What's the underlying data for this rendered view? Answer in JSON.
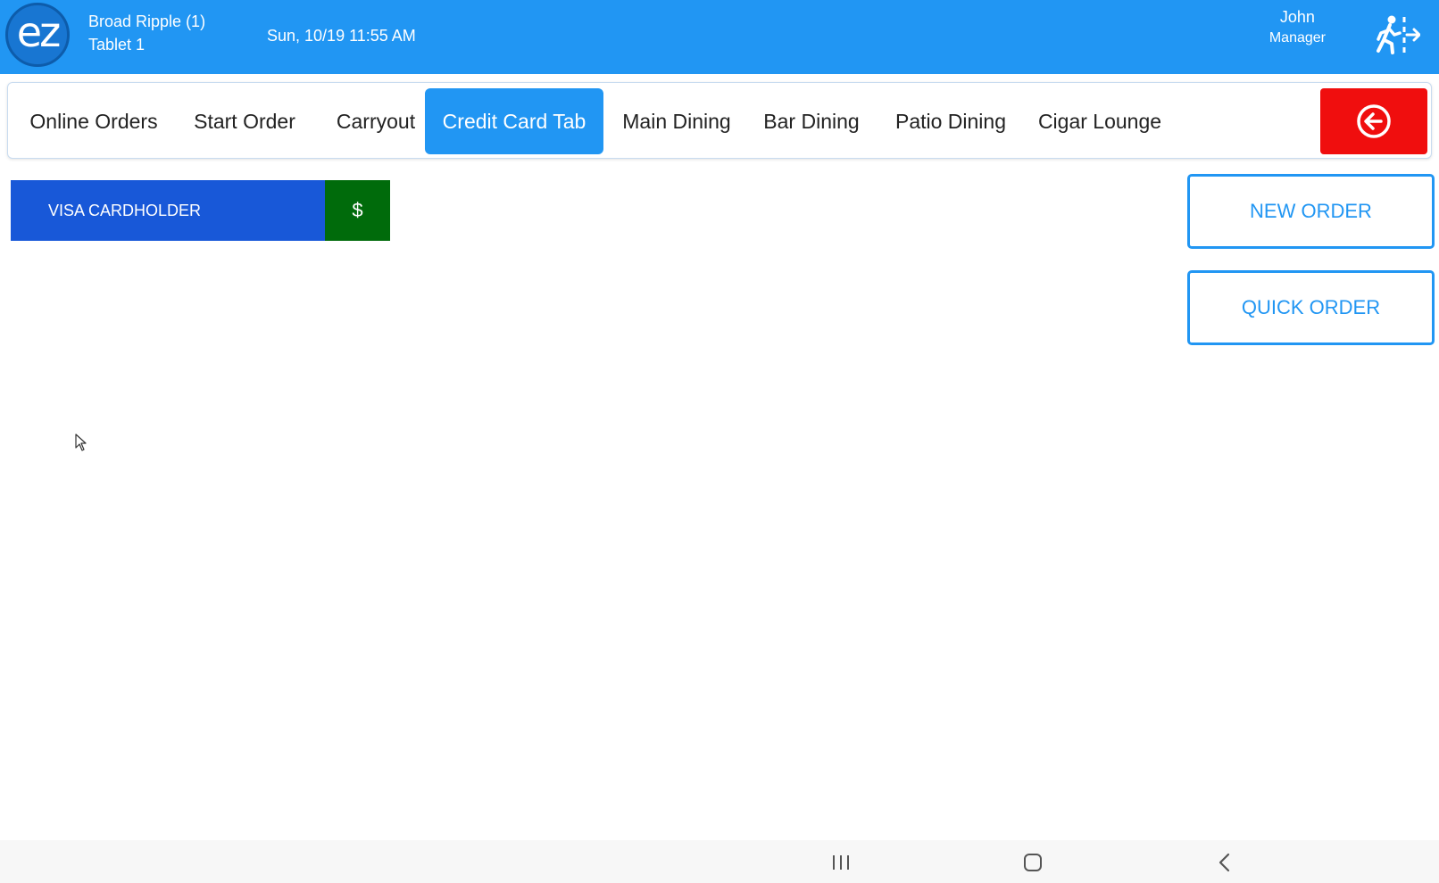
{
  "header": {
    "logo_text": "ez",
    "location": "Broad Ripple (1)",
    "device": "Tablet 1",
    "datetime": "Sun, 10/19 11:55 AM",
    "user_name": "John",
    "user_role": "Manager",
    "exit_icon": "exit-running-person-icon"
  },
  "tabs": [
    {
      "label": "Online Orders",
      "active": false
    },
    {
      "label": "Start Order",
      "active": false
    },
    {
      "label": "Carryout",
      "active": false
    },
    {
      "label": "Credit Card Tab",
      "active": true
    },
    {
      "label": "Main Dining",
      "active": false
    },
    {
      "label": "Bar Dining",
      "active": false
    },
    {
      "label": "Patio Dining",
      "active": false
    },
    {
      "label": "Cigar Lounge",
      "active": false
    }
  ],
  "back_button_icon": "circle-arrow-left-icon",
  "orders": [
    {
      "name": "VISA CARDHOLDER",
      "pay_label": "$"
    }
  ],
  "actions": {
    "new_order": "NEW ORDER",
    "quick_order": "QUICK ORDER"
  },
  "colors": {
    "header_bg": "#2196f3",
    "active_tab": "#2196f3",
    "back_button": "#f00e0e",
    "order_card": "#1858d8",
    "pay_button": "#006b0b"
  }
}
